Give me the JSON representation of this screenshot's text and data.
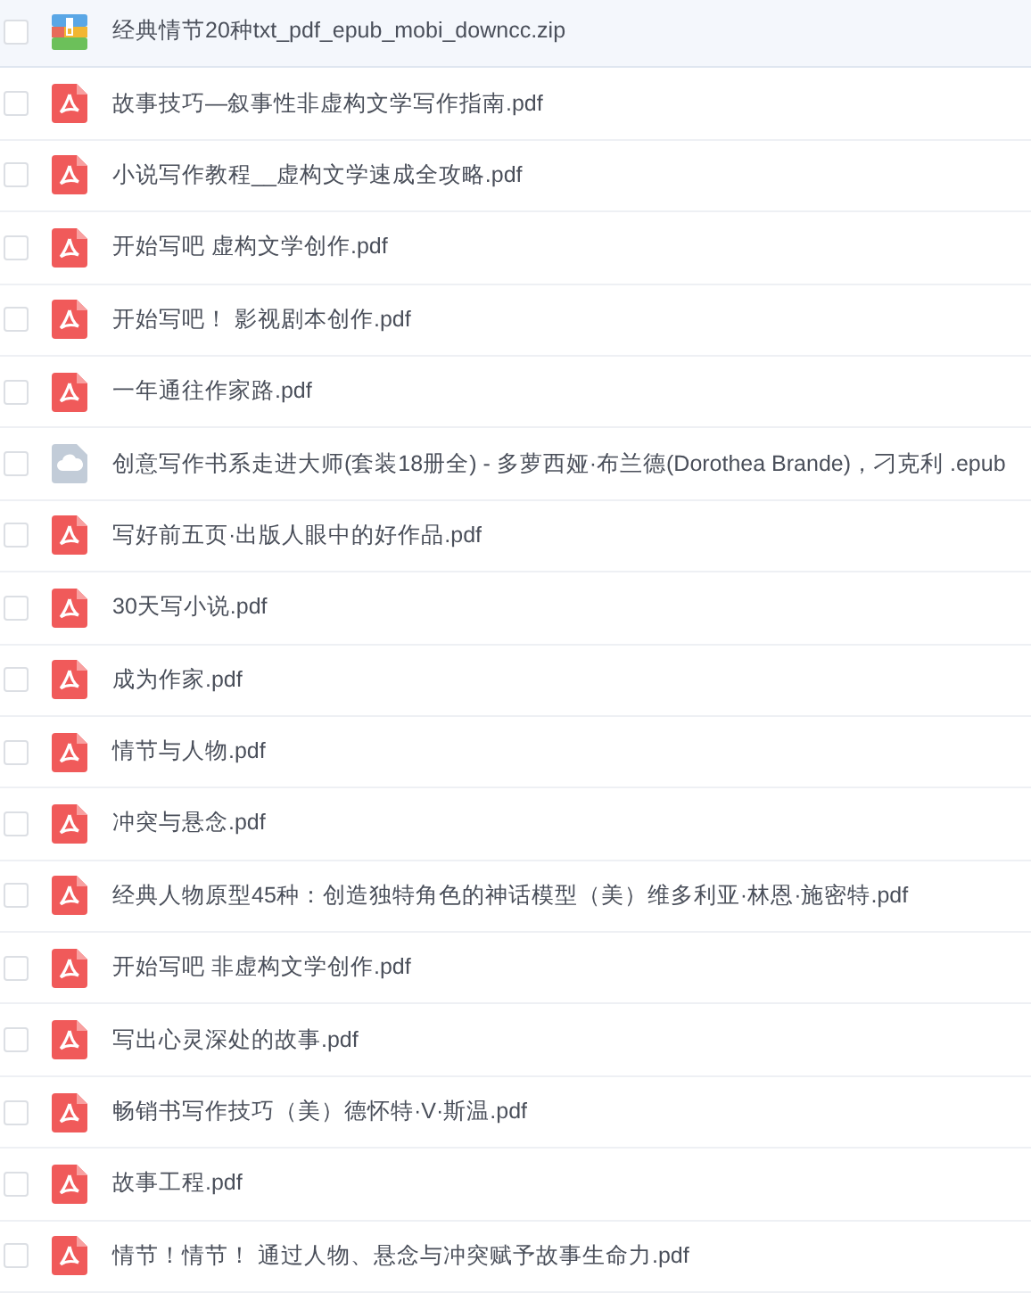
{
  "files": [
    {
      "name": "经典情节20种txt_pdf_epub_mobi_downcc.zip",
      "kind": "zip",
      "checked": false,
      "highlighted": true
    },
    {
      "name": "故事技巧—叙事性非虚构文学写作指南.pdf",
      "kind": "pdf",
      "checked": false,
      "highlighted": false
    },
    {
      "name": "小说写作教程__虚构文学速成全攻略.pdf",
      "kind": "pdf",
      "checked": false,
      "highlighted": false
    },
    {
      "name": "开始写吧 虚构文学创作.pdf",
      "kind": "pdf",
      "checked": false,
      "highlighted": false
    },
    {
      "name": "开始写吧！ 影视剧本创作.pdf",
      "kind": "pdf",
      "checked": false,
      "highlighted": false
    },
    {
      "name": "一年通往作家路.pdf",
      "kind": "pdf",
      "checked": false,
      "highlighted": false
    },
    {
      "name": "创意写作书系走进大师(套装18册全) - 多萝西娅·布兰德(Dorothea Brande)，刁克利 .epub",
      "kind": "epub",
      "checked": false,
      "highlighted": false
    },
    {
      "name": "写好前五页·出版人眼中的好作品.pdf",
      "kind": "pdf",
      "checked": false,
      "highlighted": false
    },
    {
      "name": "30天写小说.pdf",
      "kind": "pdf",
      "checked": false,
      "highlighted": false
    },
    {
      "name": "成为作家.pdf",
      "kind": "pdf",
      "checked": false,
      "highlighted": false
    },
    {
      "name": "情节与人物.pdf",
      "kind": "pdf",
      "checked": false,
      "highlighted": false
    },
    {
      "name": "冲突与悬念.pdf",
      "kind": "pdf",
      "checked": false,
      "highlighted": false
    },
    {
      "name": "经典人物原型45种：创造独特角色的神话模型（美）维多利亚·林恩·施密特.pdf",
      "kind": "pdf",
      "checked": false,
      "highlighted": false
    },
    {
      "name": "开始写吧 非虚构文学创作.pdf",
      "kind": "pdf",
      "checked": false,
      "highlighted": false
    },
    {
      "name": "写出心灵深处的故事.pdf",
      "kind": "pdf",
      "checked": false,
      "highlighted": false
    },
    {
      "name": "畅销书写作技巧（美）德怀特·V·斯温.pdf",
      "kind": "pdf",
      "checked": false,
      "highlighted": false
    },
    {
      "name": "故事工程.pdf",
      "kind": "pdf",
      "checked": false,
      "highlighted": false
    },
    {
      "name": "情节！情节！ 通过人物、悬念与冲突赋予故事生命力.pdf",
      "kind": "pdf",
      "checked": false,
      "highlighted": false
    }
  ]
}
